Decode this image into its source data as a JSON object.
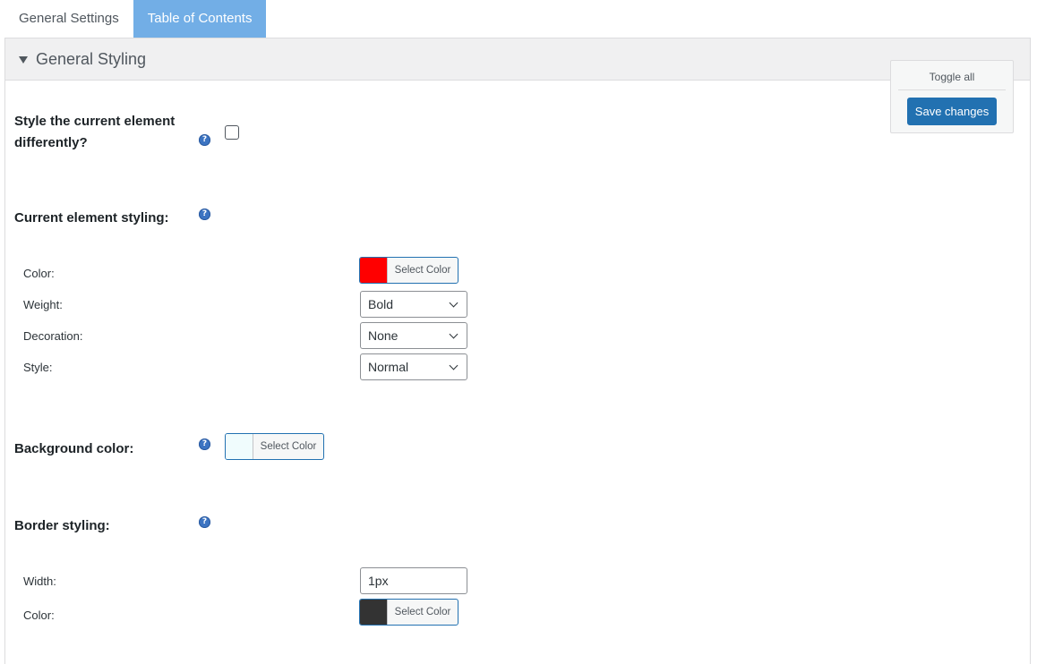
{
  "tabs": [
    {
      "label": "General Settings",
      "active": false
    },
    {
      "label": "Table of Contents",
      "active": true
    }
  ],
  "section": {
    "title": "General Styling",
    "expanded": true
  },
  "toolbar": {
    "toggle_all": "Toggle all",
    "save_label": "Save changes"
  },
  "fields": {
    "style_current": {
      "label": "Style the current element differently?",
      "checked": false
    },
    "current_styling": {
      "label": "Current element styling:",
      "color": {
        "label": "Color:",
        "button": "Select Color",
        "value": "#ff0000"
      },
      "weight": {
        "label": "Weight:",
        "value": "Bold"
      },
      "decoration": {
        "label": "Decoration:",
        "value": "None"
      },
      "style": {
        "label": "Style:",
        "value": "Normal"
      }
    },
    "background": {
      "label": "Background color:",
      "button": "Select Color",
      "value": "#f0fcfd"
    },
    "border": {
      "label": "Border styling:",
      "width": {
        "label": "Width:",
        "value": "1px"
      },
      "color": {
        "label": "Color:",
        "button": "Select Color",
        "value": "#333333"
      }
    }
  },
  "help_icon_glyph": "?",
  "colors": {
    "accent": "#2271b1",
    "active_tab": "#72aee6"
  }
}
